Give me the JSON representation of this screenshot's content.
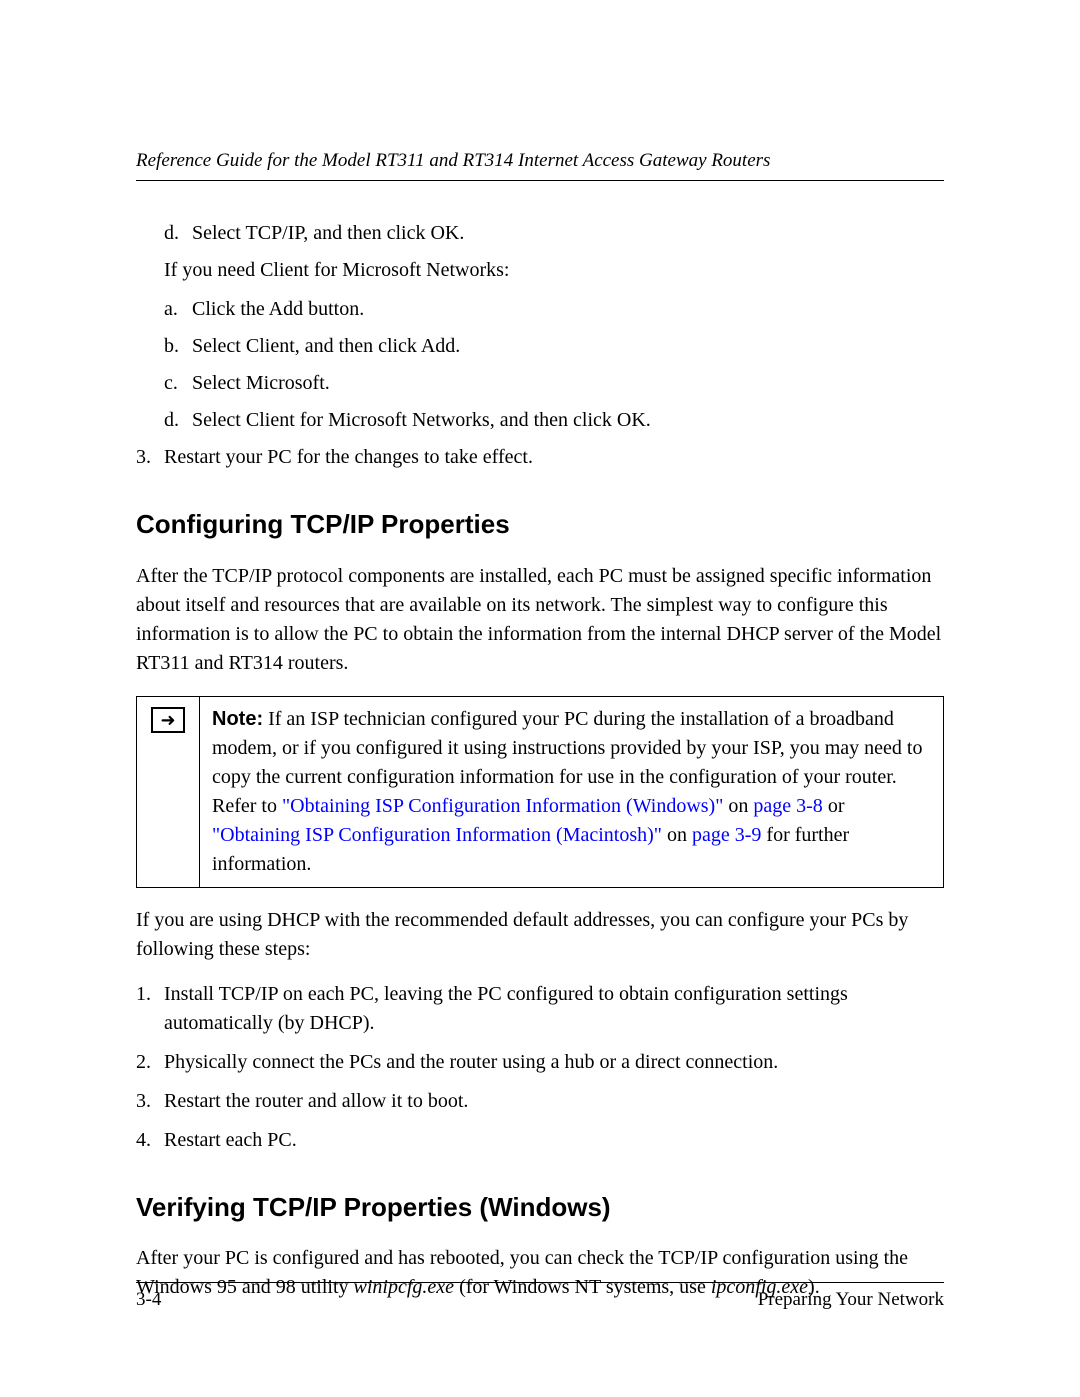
{
  "header": {
    "title": "Reference Guide for the Model RT311 and RT314 Internet Access Gateway Routers"
  },
  "list1": {
    "d": "Select TCP/IP, and then click OK."
  },
  "intro2": "If you need Client for Microsoft Networks:",
  "list2": {
    "a": "Click the Add button.",
    "b": "Select Client, and then click Add.",
    "c": "Select Microsoft.",
    "d": "Select Client for Microsoft Networks, and then click OK."
  },
  "step3": "Restart your PC for the changes to take effect.",
  "section1": {
    "heading": "Configuring TCP/IP Properties",
    "para": "After the TCP/IP protocol components are installed, each PC must be assigned specific information about itself and resources that are available on its network. The simplest way to configure this information is to allow the PC to obtain the information from the internal DHCP server of the Model RT311 and RT314 routers."
  },
  "note": {
    "label": "Note:",
    "t1": " If an ISP technician configured your PC during the installation of a broadband modem, or if you configured it using instructions provided by your ISP, you may need to copy the current configuration information for use in the configuration of your router. Refer to ",
    "link1a": "\"Obtaining ISP Configuration Information (Windows)\"",
    "t2": " on ",
    "link1b": "page 3-8",
    "t3": " or ",
    "link2a": "\"Obtaining ISP Configuration Information (Macintosh)\"",
    "t4": " on ",
    "link2b": "page 3-9",
    "t5": " for further information."
  },
  "para2": "If you are using DHCP with the recommended default addresses, you can configure your PCs by following these steps:",
  "steps": {
    "s1": "Install TCP/IP on each PC, leaving the PC configured to obtain configuration settings automatically (by DHCP).",
    "s2": "Physically connect the PCs and the router using a hub or a direct connection.",
    "s3": "Restart the router and allow it to boot.",
    "s4": "Restart each PC."
  },
  "section2": {
    "heading": "Verifying TCP/IP Properties (Windows)",
    "p1": "After your PC is configured and has rebooted, you can check the TCP/IP configuration using the Windows 95 and 98 utility ",
    "i1": "winipcfg.exe",
    "p2": " (for Windows NT systems, use ",
    "i2": "ipconfig.exe",
    "p3": ")."
  },
  "footer": {
    "left": "3-4",
    "right": "Preparing Your Network"
  },
  "icon": {
    "arrow": "➜"
  }
}
